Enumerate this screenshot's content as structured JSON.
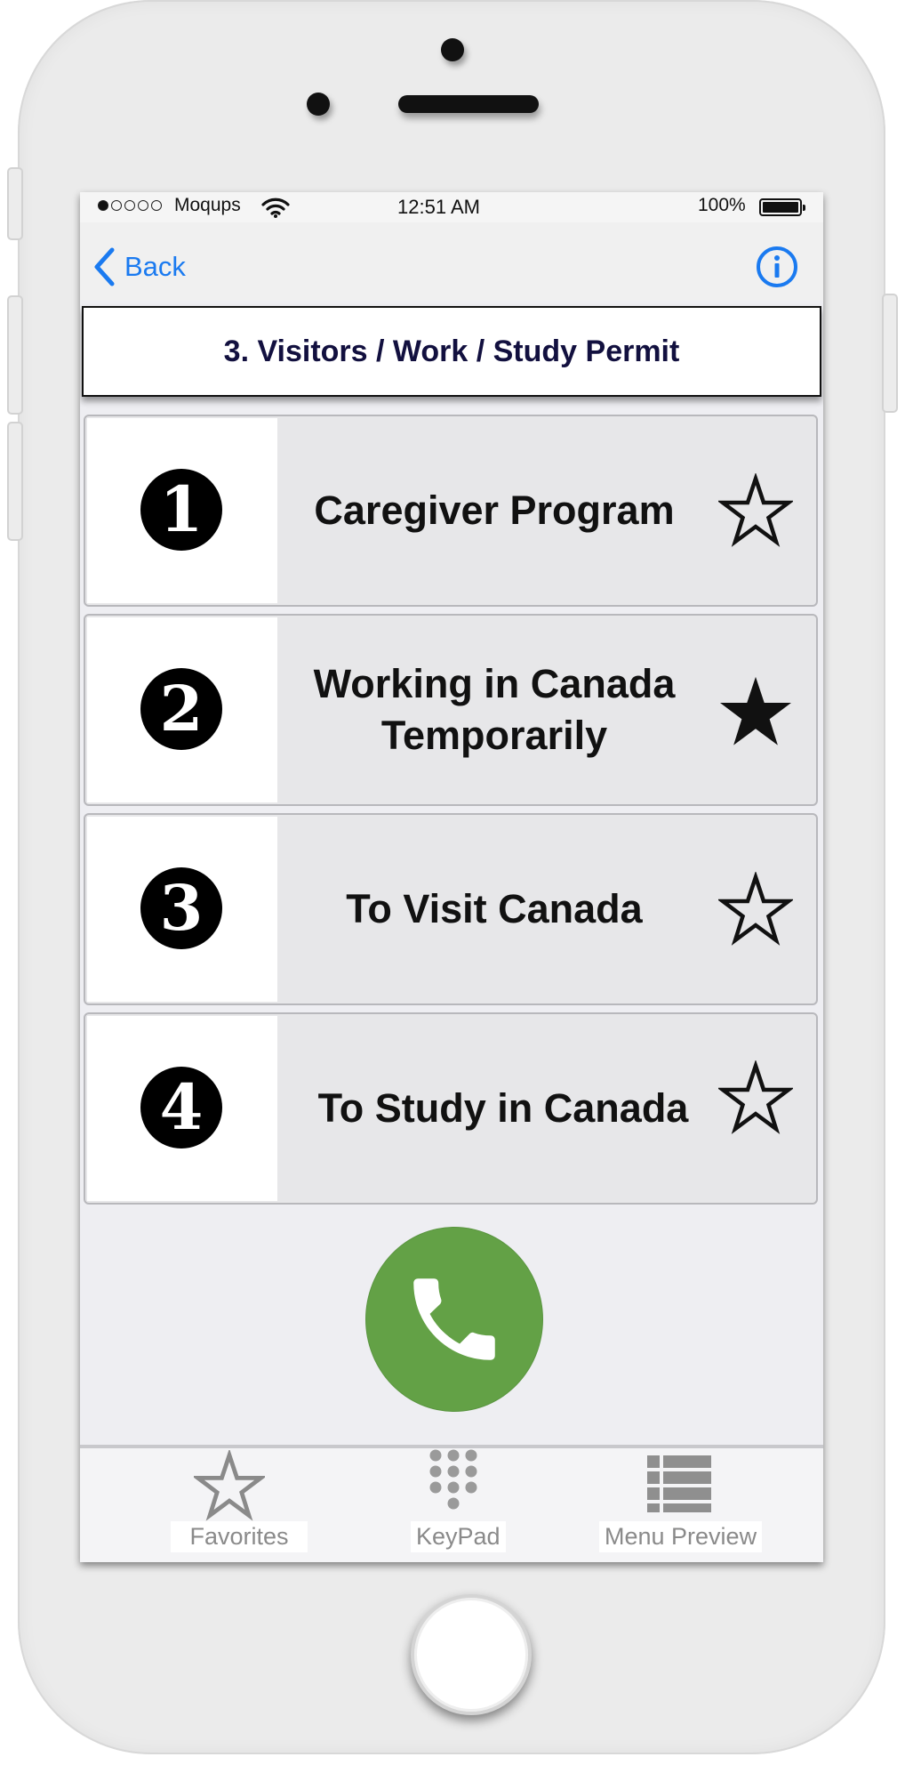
{
  "status_bar": {
    "carrier": "Moqups",
    "time": "12:51 AM",
    "battery": "100%",
    "signal_dots_filled": 1,
    "signal_dots_total": 5
  },
  "nav": {
    "back_label": "Back"
  },
  "page_title": "3. Visitors / Work / Study Permit",
  "items": [
    {
      "number": "1",
      "label": "Caregiver Program",
      "favorited": false
    },
    {
      "number": "2",
      "label": "Working in Canada\nTemporarily",
      "favorited": true
    },
    {
      "number": "3",
      "label": "To Visit Canada",
      "favorited": false
    },
    {
      "number": "4",
      "label": "To Study in Canada",
      "favorited": false
    }
  ],
  "tabs": [
    {
      "label": "Favorites",
      "icon": "star-outline-icon"
    },
    {
      "label": "KeyPad",
      "icon": "keypad-icon"
    },
    {
      "label": "Menu Preview",
      "icon": "list-icon"
    }
  ],
  "colors": {
    "accent": "#1a7af0",
    "call_button": "#63a146",
    "title_text": "#12103f",
    "tab_icon": "#8a8a8a"
  }
}
